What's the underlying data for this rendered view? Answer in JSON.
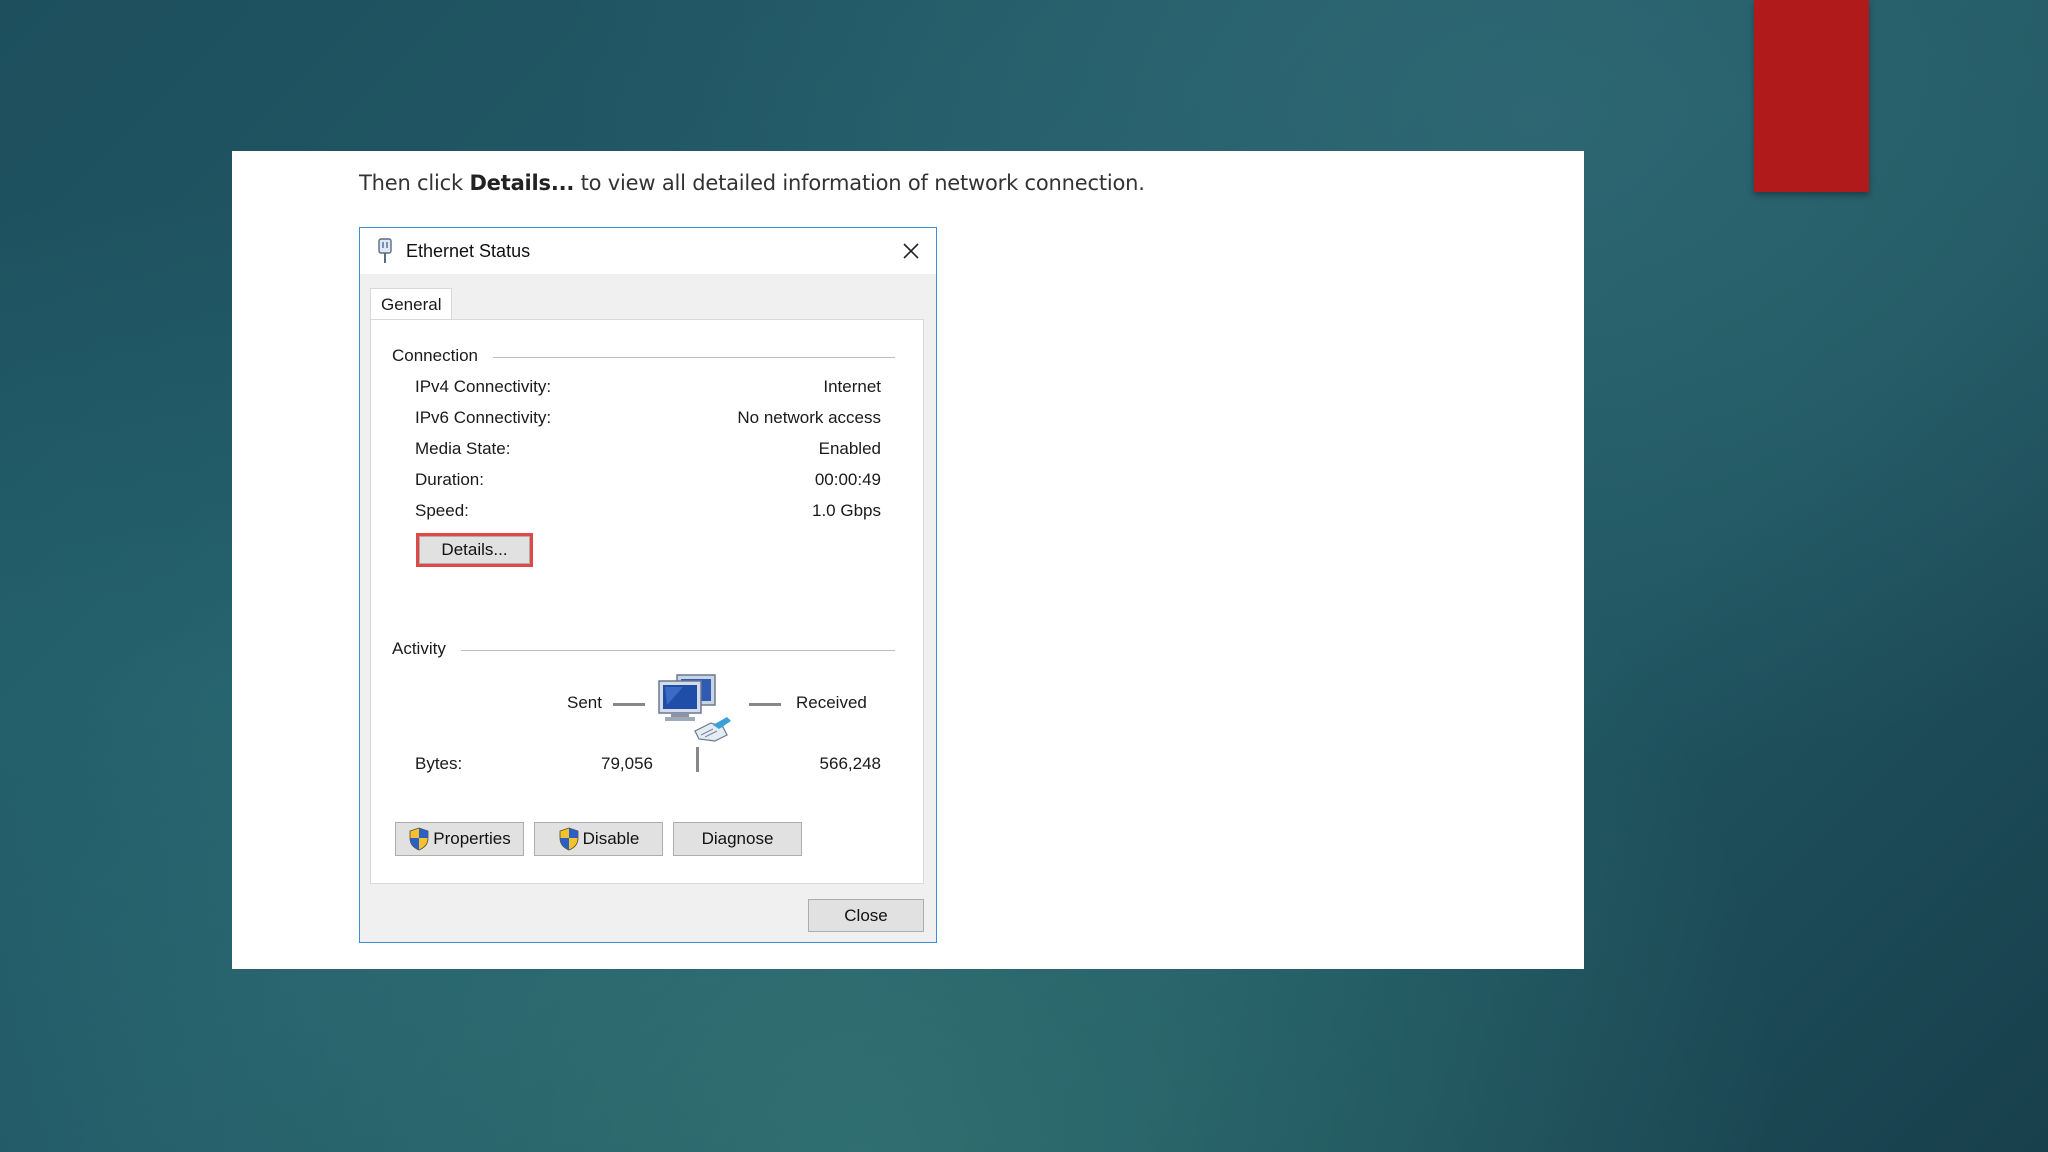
{
  "slide": {
    "instruction_pre": "Then click ",
    "instruction_bold": "Details...",
    "instruction_post": " to view all detailed information of network connection."
  },
  "dialog": {
    "title": "Ethernet Status",
    "tab": "General",
    "connection": {
      "group_label": "Connection",
      "rows": [
        {
          "label": "IPv4 Connectivity:",
          "value": "Internet"
        },
        {
          "label": "IPv6 Connectivity:",
          "value": "No network access"
        },
        {
          "label": "Media State:",
          "value": "Enabled"
        },
        {
          "label": "Duration:",
          "value": "00:00:49"
        },
        {
          "label": "Speed:",
          "value": "1.0 Gbps"
        }
      ],
      "details_button": "Details..."
    },
    "activity": {
      "group_label": "Activity",
      "sent_label": "Sent",
      "received_label": "Received",
      "bytes_label": "Bytes:",
      "bytes_sent": "79,056",
      "bytes_received": "566,248"
    },
    "buttons": {
      "properties": "Properties",
      "disable": "Disable",
      "diagnose": "Diagnose",
      "close": "Close"
    }
  },
  "icons": {
    "title": "ethernet-icon",
    "close": "close-icon",
    "network": "network-computers-icon",
    "shield": "uac-shield-icon"
  },
  "colors": {
    "dialog_border": "#3a8ed6",
    "highlight": "#e04848",
    "accent_bar": "#b01a1a"
  }
}
